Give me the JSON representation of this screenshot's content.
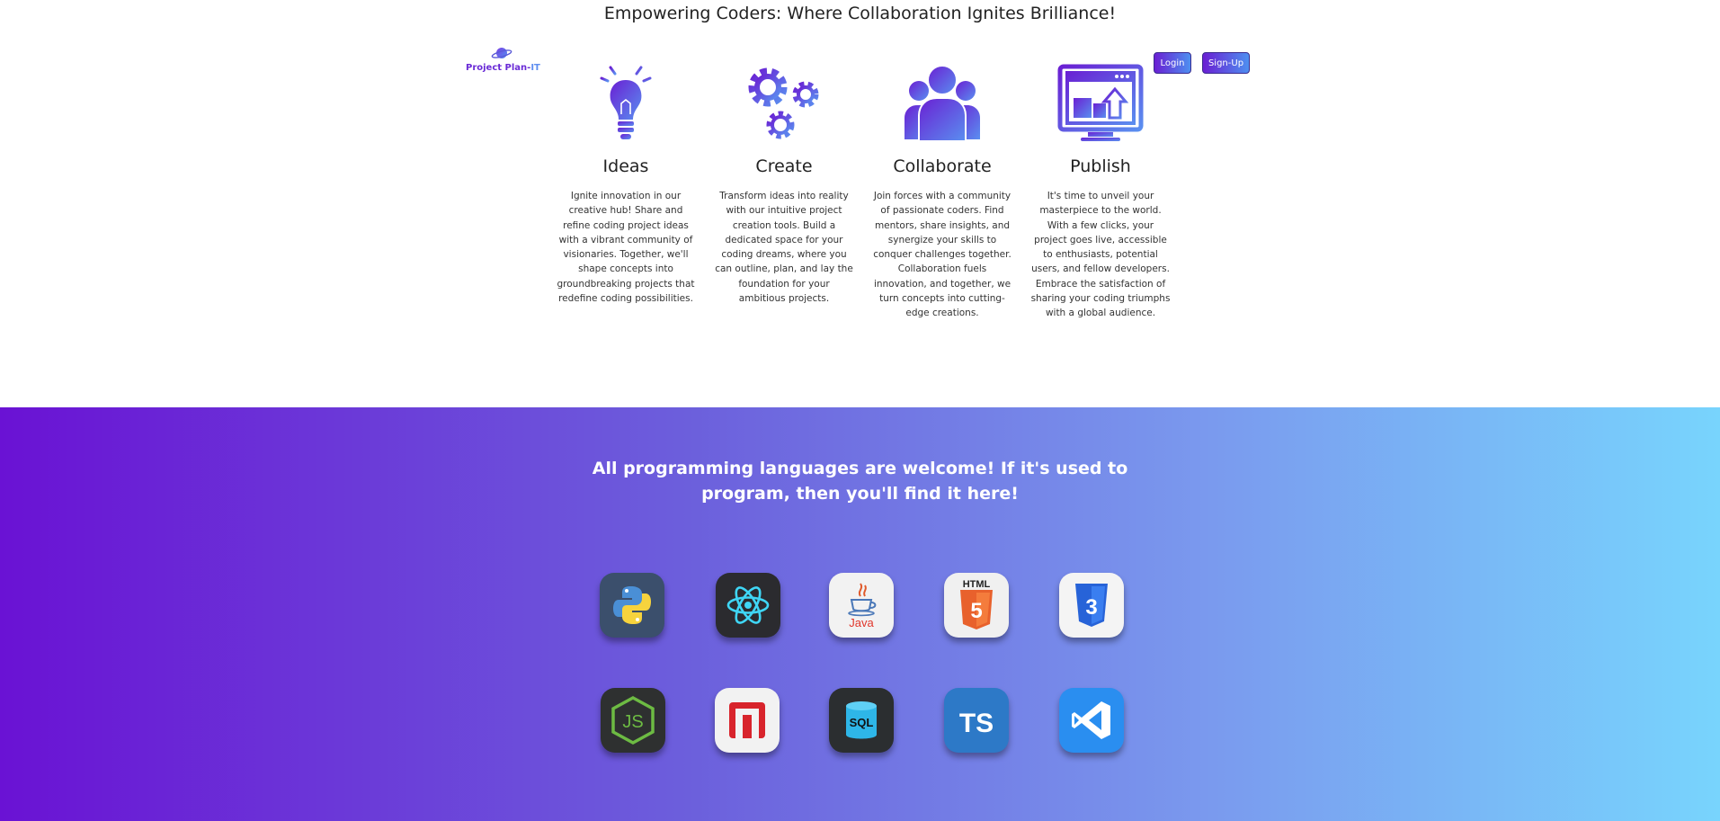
{
  "headline": "Empowering Coders: Where Collaboration Ignites Brilliance!",
  "logo": {
    "name_main": "Project Plan-",
    "name_accent": "IT",
    "icon": "planet-icon"
  },
  "auth": {
    "login_label": "Login",
    "signup_label": "Sign-Up"
  },
  "features": [
    {
      "title": "Ideas",
      "icon": "lightbulb-icon",
      "text": "Ignite innovation in our creative hub! Share and refine coding project ideas with a vibrant community of visionaries. Together, we'll shape concepts into groundbreaking projects that redefine coding possibilities."
    },
    {
      "title": "Create",
      "icon": "gears-icon",
      "text": "Transform ideas into reality with our intuitive project creation tools. Build a dedicated space for your coding dreams, where you can outline, plan, and lay the foundation for your ambitious projects."
    },
    {
      "title": "Collaborate",
      "icon": "people-icon",
      "text": "Join forces with a community of passionate coders. Find mentors, share insights, and synergize your skills to conquer challenges together. Collaboration fuels innovation, and together, we turn concepts into cutting-edge creations."
    },
    {
      "title": "Publish",
      "icon": "monitor-upload-icon",
      "text": "It's time to unveil your masterpiece to the world. With a few clicks, your project goes live, accessible to enthusiasts, potential users, and fellow developers. Embrace the satisfaction of sharing your coding triumphs with a global audience."
    }
  ],
  "languages_banner": "All programming languages are welcome! If it's used to program, then you'll find it here!",
  "languages": {
    "row1": [
      {
        "icon": "python-icon"
      },
      {
        "icon": "react-icon"
      },
      {
        "icon": "java-icon",
        "label": "Java"
      },
      {
        "icon": "html5-icon",
        "label": "HTML"
      },
      {
        "icon": "css3-icon"
      }
    ],
    "row2": [
      {
        "icon": "nodejs-icon",
        "label": "JS"
      },
      {
        "icon": "npm-icon"
      },
      {
        "icon": "sql-icon",
        "label": "SQL"
      },
      {
        "icon": "typescript-icon",
        "label": "TS"
      },
      {
        "icon": "vscode-icon"
      }
    ]
  },
  "colors": {
    "brand_purple": "#6a12d4",
    "brand_light_blue": "#78d4fd",
    "logo_text": "#6a2bd6"
  }
}
